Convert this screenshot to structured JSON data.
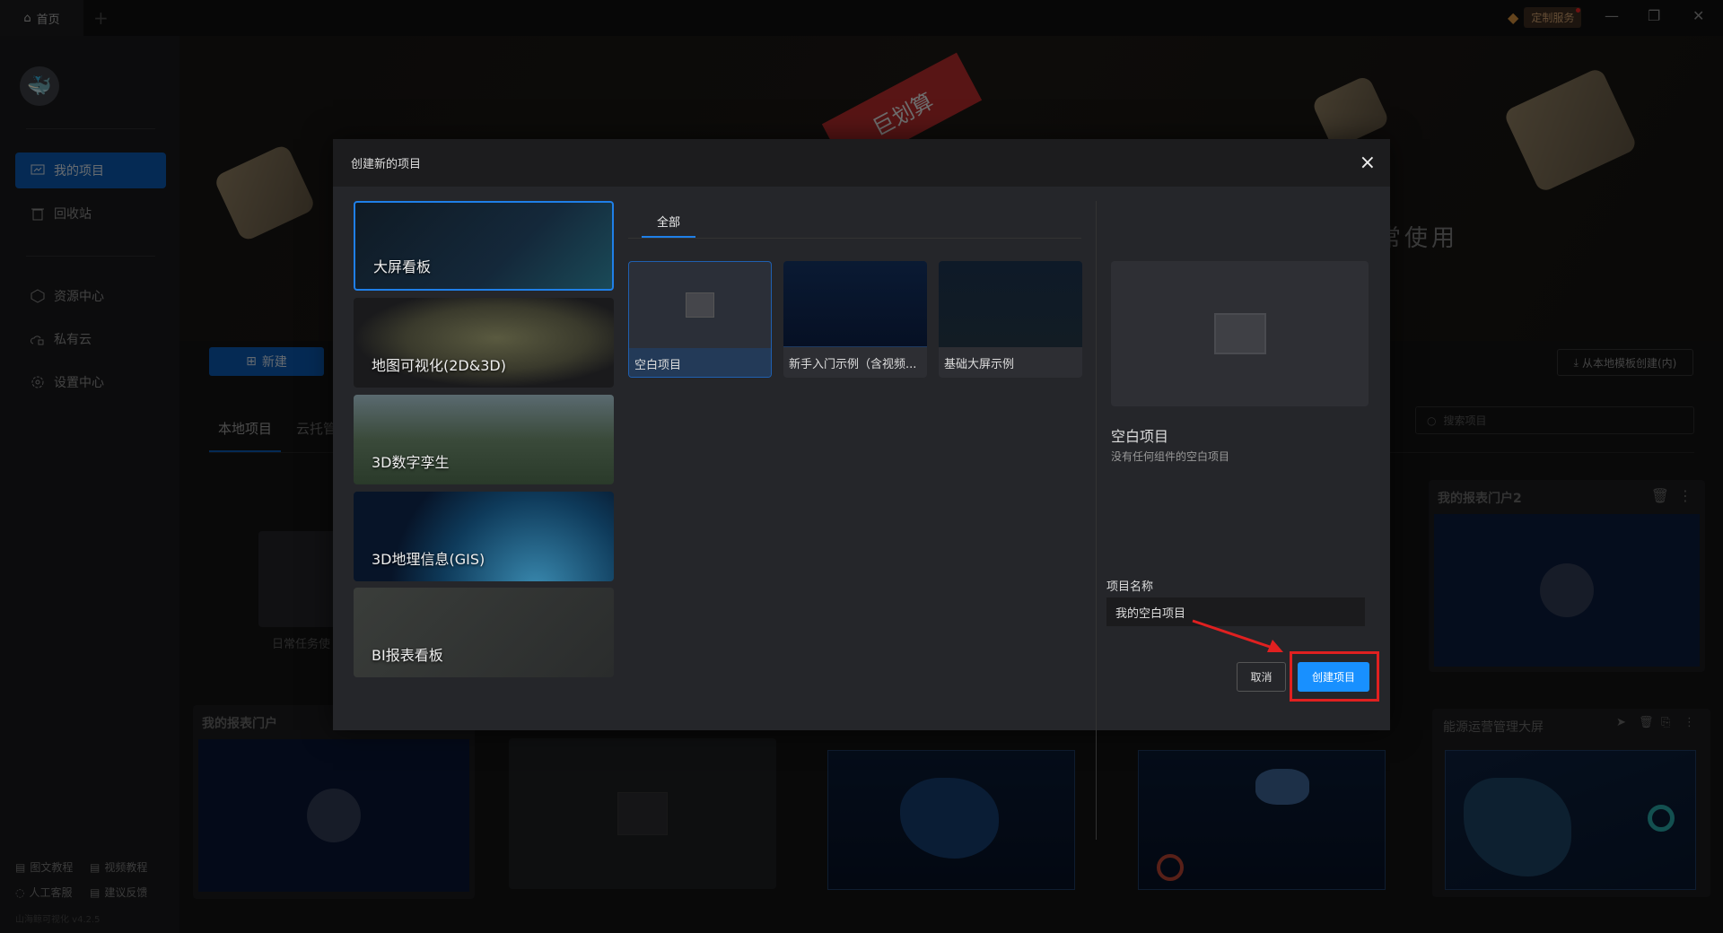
{
  "titlebar": {
    "home_tab": "首页",
    "vip_label": "定制服务"
  },
  "sidebar": {
    "items": [
      {
        "label": "我的项目",
        "icon": "presentation-chart-icon",
        "active": true
      },
      {
        "label": "回收站",
        "icon": "trash-icon"
      },
      {
        "label": "资源中心",
        "icon": "hexagon-icon"
      },
      {
        "label": "私有云",
        "icon": "cloud-lock-icon"
      },
      {
        "label": "设置中心",
        "icon": "gear-icon"
      }
    ],
    "footer": [
      {
        "label": "图文教程"
      },
      {
        "label": "视频教程"
      },
      {
        "label": "人工客服"
      },
      {
        "label": "建议反馈"
      }
    ],
    "version": "山海鲸可视化 v4.2.5"
  },
  "banner": {
    "badge": "巨划算",
    "slogan": "常使用"
  },
  "main": {
    "new_button": "新建",
    "import_button": "从本地模板创建(内)",
    "search_placeholder": "搜索项目",
    "tabs": [
      {
        "label": "本地项目",
        "active": true
      },
      {
        "label": "云托管"
      }
    ],
    "folder_caption": "日常任务使",
    "cards": [
      {
        "title": "我的报表门户2"
      },
      {
        "title": "我的报表门户"
      },
      {
        "title": "能源运营管理大屏"
      }
    ]
  },
  "dialog": {
    "title": "创建新的项目",
    "categories": [
      {
        "label": "大屏看板",
        "selected": true
      },
      {
        "label": "地图可视化(2D&3D)"
      },
      {
        "label": "3D数字孪生"
      },
      {
        "label": "3D地理信息(GIS)"
      },
      {
        "label": "BI报表看板"
      }
    ],
    "filter_tabs": [
      {
        "label": "全部",
        "active": true
      }
    ],
    "templates": [
      {
        "label": "空白项目",
        "selected": true
      },
      {
        "label": "新手入门示例（含视频..."
      },
      {
        "label": "基础大屏示例"
      }
    ],
    "preview": {
      "title": "空白项目",
      "description": "没有任何组件的空白项目"
    },
    "name_label": "项目名称",
    "name_value": "我的空白项目",
    "cancel": "取消",
    "create": "创建项目"
  },
  "colors": {
    "accent": "#1890ff",
    "highlight": "#e02020"
  }
}
